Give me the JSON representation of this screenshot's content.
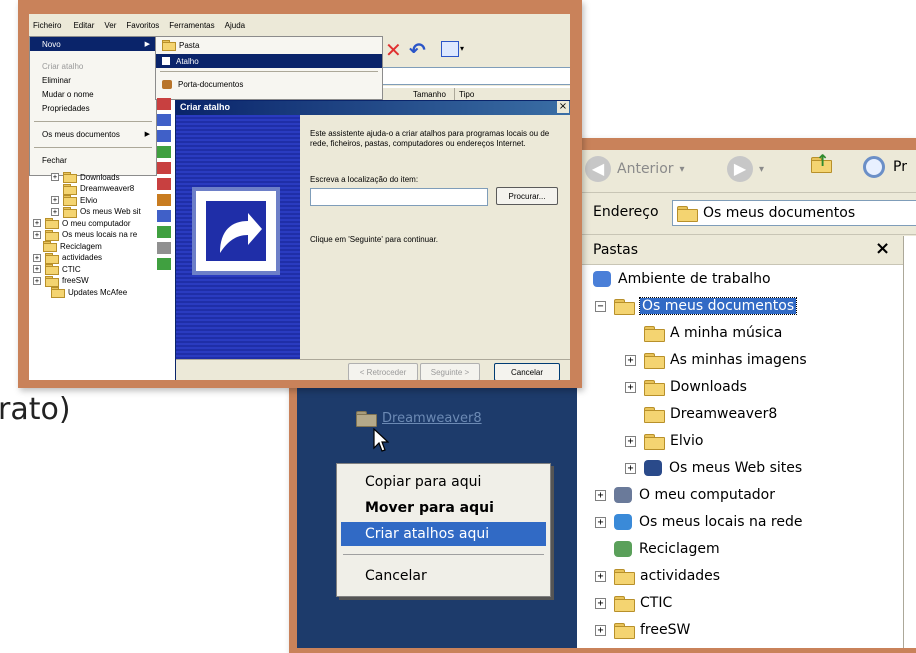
{
  "background_text": "rato)",
  "explorer": {
    "toolbar": {
      "back_label": "Anterior",
      "search_partial": "Pr"
    },
    "address": {
      "label": "Endereço",
      "value": "Os meus documentos"
    },
    "folders_pane": {
      "title": "Pastas",
      "close": "×"
    },
    "tree": [
      {
        "label": "Ambiente de trabalho",
        "level": 0,
        "expander": "",
        "icon": "desktop-icon"
      },
      {
        "label": "Os meus documentos",
        "level": 1,
        "expander": "−",
        "icon": "documents-folder-icon",
        "selected": true
      },
      {
        "label": "A minha música",
        "level": 2,
        "expander": "",
        "icon": "music-folder-icon"
      },
      {
        "label": "As minhas imagens",
        "level": 2,
        "expander": "+",
        "icon": "pictures-folder-icon"
      },
      {
        "label": "Downloads",
        "level": 2,
        "expander": "+",
        "icon": "folder-icon"
      },
      {
        "label": "Dreamweaver8",
        "level": 2,
        "expander": "",
        "icon": "folder-icon"
      },
      {
        "label": "Elvio",
        "level": 2,
        "expander": "+",
        "icon": "folder-icon"
      },
      {
        "label": "Os meus Web sites",
        "level": 2,
        "expander": "+",
        "icon": "web-sites-icon"
      },
      {
        "label": "O meu computador",
        "level": 1,
        "expander": "+",
        "icon": "computer-icon"
      },
      {
        "label": "Os meus locais na rede",
        "level": 1,
        "expander": "+",
        "icon": "network-icon"
      },
      {
        "label": "Reciclagem",
        "level": 1,
        "expander": "",
        "icon": "recycle-bin-icon"
      },
      {
        "label": "actividades",
        "level": 1,
        "expander": "+",
        "icon": "folder-icon"
      },
      {
        "label": "CTIC",
        "level": 1,
        "expander": "+",
        "icon": "folder-icon"
      },
      {
        "label": "freeSW",
        "level": 1,
        "expander": "+",
        "icon": "folder-icon"
      }
    ]
  },
  "desktop": {
    "folder_label": "Dreamweaver8",
    "context_menu": {
      "items": [
        "Copiar para aqui",
        "Mover para aqui",
        "Criar atalhos aqui",
        "Cancelar"
      ]
    }
  },
  "top_window": {
    "menubar": [
      "Ficheiro",
      "Editar",
      "Ver",
      "Favoritos",
      "Ferramentas",
      "Ajuda"
    ],
    "file_menu": [
      "Novo",
      "Criar atalho",
      "Eliminar",
      "Mudar o nome",
      "Propriedades",
      "Os meus documentos",
      "Fechar"
    ],
    "new_submenu": [
      "Pasta",
      "Atalho",
      "Porta-documentos"
    ],
    "column_headers": [
      "Tamanho",
      "Tipo"
    ],
    "left_tree": [
      "Downloads",
      "Dreamweaver8",
      "Elvio",
      "Os meus Web sit",
      "O meu computador",
      "Os meus locais na re",
      "Reciclagem",
      "actividades",
      "CTIC",
      "freeSW",
      "Updates McAfee"
    ],
    "wizard": {
      "title": "Criar atalho",
      "close": "×",
      "intro": "Este assistente ajuda-o a criar atalhos para programas locais ou de rede, ficheiros, pastas, computadores ou endereços Internet.",
      "location_label": "Escreva a localização do item:",
      "location_value": "",
      "browse_button": "Procurar...",
      "hint": "Clique em 'Seguinte' para continuar.",
      "back_button": "< Retroceder",
      "next_button": "Seguinte >",
      "cancel_button": "Cancelar"
    }
  },
  "colors": {
    "frame": "#c9825a",
    "xp_blue": "#0a246a",
    "selection": "#316ac5",
    "desktop": "#1d3b6b"
  }
}
